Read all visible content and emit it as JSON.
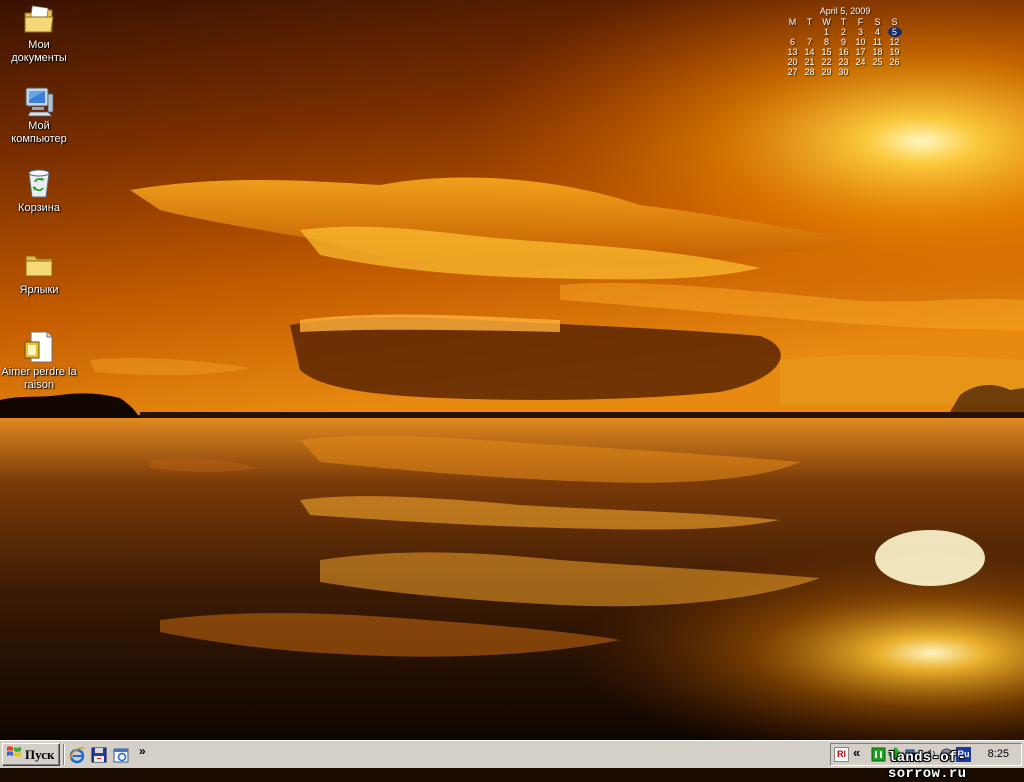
{
  "desktop": {
    "icons": [
      {
        "label": "Мои документы",
        "icon": "my-documents-folder-icon"
      },
      {
        "label": "Мой компьютер",
        "icon": "my-computer-icon"
      },
      {
        "label": "Корзина",
        "icon": "recycle-bin-icon"
      },
      {
        "label": "Ярлыки",
        "icon": "folder-icon"
      },
      {
        "label": "Aimer perdre la raison",
        "icon": "image-file-icon"
      }
    ]
  },
  "calendar": {
    "title": "April 5, 2009",
    "weekdays": [
      "M",
      "T",
      "W",
      "T",
      "F",
      "S",
      "S"
    ],
    "days": [
      "",
      "",
      "1",
      "2",
      "3",
      "4",
      "5",
      "6",
      "7",
      "8",
      "9",
      "10",
      "11",
      "12",
      "13",
      "14",
      "15",
      "16",
      "17",
      "18",
      "19",
      "20",
      "21",
      "22",
      "23",
      "24",
      "25",
      "26",
      "27",
      "28",
      "29",
      "30"
    ],
    "today": "5",
    "today_color": "#12306e"
  },
  "taskbar": {
    "start_label": "Пуск",
    "quick_launch": [
      "internet-explorer-icon",
      "save-disk-icon",
      "browser-window-icon"
    ],
    "quick_launch_more": "»",
    "tray": {
      "expand": "«",
      "icons": [
        "rl-tray-icon",
        "green-tray-icon",
        "puzzle-tray-icon",
        "network-tray-icon",
        "volume-tray-icon",
        "language-ru-icon"
      ],
      "rl_text": "Rl",
      "lang_text": "Ru",
      "clock": "8:25"
    }
  },
  "watermark": "lands-of-sorrow.ru",
  "colors": {
    "taskbar": "#d4d0c8",
    "sky_top": "#4a1a00",
    "sun": "#fff2a0"
  }
}
